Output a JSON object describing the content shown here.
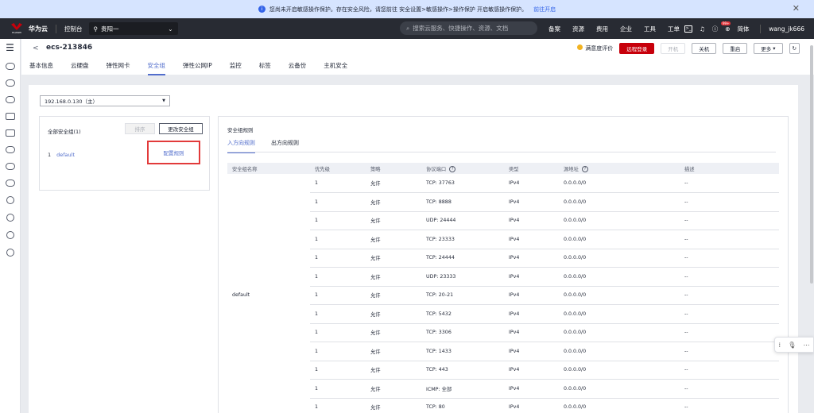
{
  "notice": {
    "text": "您尚未开启敏感操作保护。存在安全风险，请您前往 安全设置>敏感操作>操作保护 开启敏感操作保护。",
    "link": "前往开启"
  },
  "topbar": {
    "brand": "华为云",
    "logo_caption": "HUAWEI",
    "console": "控制台",
    "region": "贵阳一",
    "search_placeholder": "搜索云服务、快捷操作、资源、文档",
    "links": [
      "备案",
      "资源",
      "费用",
      "企业",
      "工具",
      "工单"
    ],
    "badge": "99+",
    "lang": "简体",
    "user": "wang_jk666"
  },
  "header": {
    "title": "ecs-213846",
    "satisfaction": "满意度评价",
    "btn_remote": "远程登录",
    "btn_start": "开机",
    "btn_stop": "关机",
    "btn_restart": "重启",
    "btn_more": "更多",
    "tabs": [
      "基本信息",
      "云硬盘",
      "弹性网卡",
      "安全组",
      "弹性公网IP",
      "监控",
      "标签",
      "云备份",
      "主机安全"
    ],
    "active_tab": "安全组"
  },
  "nic_select": "192.168.0.130（主）",
  "left_panel": {
    "title": "全部安全组(1)",
    "sort": "排序",
    "change": "更改安全组",
    "row_index": "1",
    "row_name": "default",
    "config_link": "配置规则"
  },
  "right_panel": {
    "title": "安全组规则",
    "tabs": [
      "入方向规则",
      "出方向规则"
    ],
    "columns": [
      "安全组名称",
      "优先级",
      "策略",
      "协议端口",
      "类型",
      "源地址",
      "描述"
    ],
    "group_name": "default",
    "rows": [
      {
        "priority": "1",
        "policy": "允许",
        "port": "TCP: 37763",
        "type": "IPv4",
        "source": "0.0.0.0/0",
        "desc": "--"
      },
      {
        "priority": "1",
        "policy": "允许",
        "port": "TCP: 8888",
        "type": "IPv4",
        "source": "0.0.0.0/0",
        "desc": "--"
      },
      {
        "priority": "1",
        "policy": "允许",
        "port": "UDP: 24444",
        "type": "IPv4",
        "source": "0.0.0.0/0",
        "desc": "--"
      },
      {
        "priority": "1",
        "policy": "允许",
        "port": "TCP: 23333",
        "type": "IPv4",
        "source": "0.0.0.0/0",
        "desc": "--"
      },
      {
        "priority": "1",
        "policy": "允许",
        "port": "TCP: 24444",
        "type": "IPv4",
        "source": "0.0.0.0/0",
        "desc": "--"
      },
      {
        "priority": "1",
        "policy": "允许",
        "port": "UDP: 23333",
        "type": "IPv4",
        "source": "0.0.0.0/0",
        "desc": "--"
      },
      {
        "priority": "1",
        "policy": "允许",
        "port": "TCP: 20-21",
        "type": "IPv4",
        "source": "0.0.0.0/0",
        "desc": "--"
      },
      {
        "priority": "1",
        "policy": "允许",
        "port": "TCP: 5432",
        "type": "IPv4",
        "source": "0.0.0.0/0",
        "desc": "--"
      },
      {
        "priority": "1",
        "policy": "允许",
        "port": "TCP: 3306",
        "type": "IPv4",
        "source": "0.0.0.0/0",
        "desc": "--"
      },
      {
        "priority": "1",
        "policy": "允许",
        "port": "TCP: 1433",
        "type": "IPv4",
        "source": "0.0.0.0/0",
        "desc": "--"
      },
      {
        "priority": "1",
        "policy": "允许",
        "port": "TCP: 443",
        "type": "IPv4",
        "source": "0.0.0.0/0",
        "desc": "--"
      },
      {
        "priority": "1",
        "policy": "允许",
        "port": "ICMP: 全部",
        "type": "IPv4",
        "source": "0.0.0.0/0",
        "desc": "--"
      },
      {
        "priority": "1",
        "policy": "允许",
        "port": "TCP: 80",
        "type": "IPv4",
        "source": "0.0.0.0/0",
        "desc": "--"
      }
    ]
  },
  "colors": {
    "accent": "#526ecc",
    "brand_red": "#c7000b",
    "topbar": "#282b33",
    "highlight": "#e23a3a"
  }
}
